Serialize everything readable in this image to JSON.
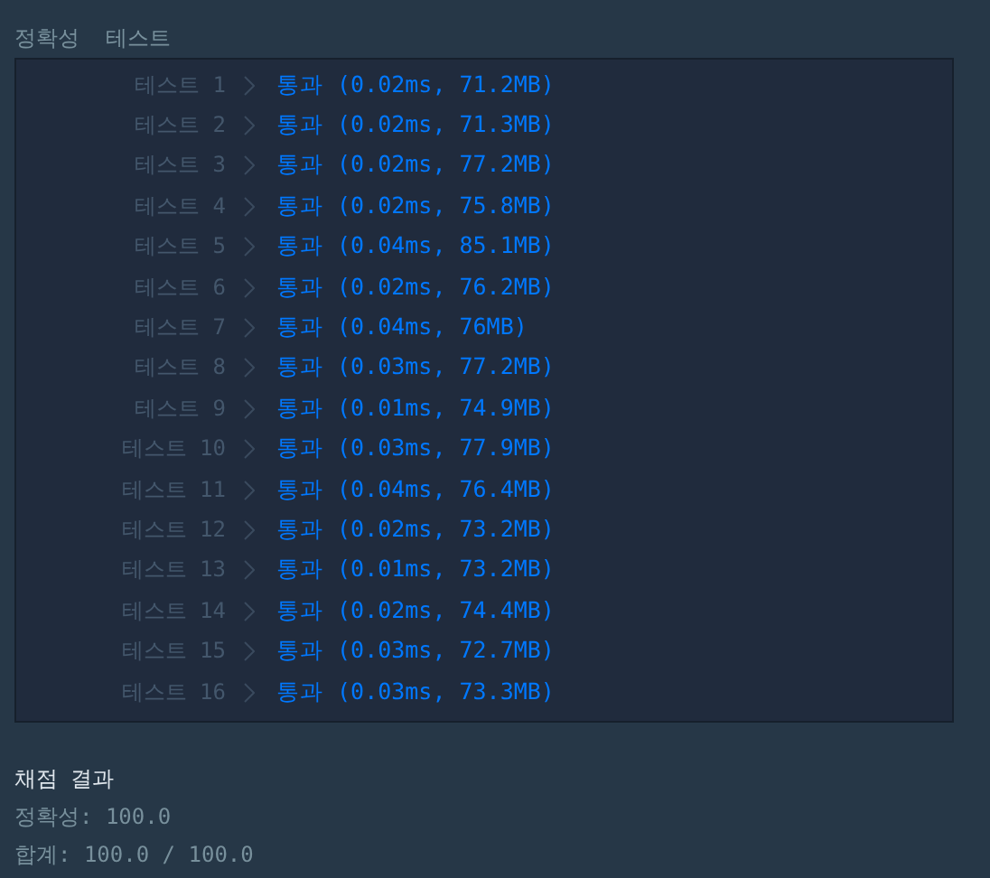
{
  "section_title": "정확성  테스트",
  "tests": [
    {
      "label": "테스트 1",
      "result": "통과 (0.02ms, 71.2MB)"
    },
    {
      "label": "테스트 2",
      "result": "통과 (0.02ms, 71.3MB)"
    },
    {
      "label": "테스트 3",
      "result": "통과 (0.02ms, 77.2MB)"
    },
    {
      "label": "테스트 4",
      "result": "통과 (0.02ms, 75.8MB)"
    },
    {
      "label": "테스트 5",
      "result": "통과 (0.04ms, 85.1MB)"
    },
    {
      "label": "테스트 6",
      "result": "통과 (0.02ms, 76.2MB)"
    },
    {
      "label": "테스트 7",
      "result": "통과 (0.04ms, 76MB)"
    },
    {
      "label": "테스트 8",
      "result": "통과 (0.03ms, 77.2MB)"
    },
    {
      "label": "테스트 9",
      "result": "통과 (0.01ms, 74.9MB)"
    },
    {
      "label": "테스트 10",
      "result": "통과 (0.03ms, 77.9MB)"
    },
    {
      "label": "테스트 11",
      "result": "통과 (0.04ms, 76.4MB)"
    },
    {
      "label": "테스트 12",
      "result": "통과 (0.02ms, 73.2MB)"
    },
    {
      "label": "테스트 13",
      "result": "통과 (0.01ms, 73.2MB)"
    },
    {
      "label": "테스트 14",
      "result": "통과 (0.02ms, 74.4MB)"
    },
    {
      "label": "테스트 15",
      "result": "통과 (0.03ms, 72.7MB)"
    },
    {
      "label": "테스트 16",
      "result": "통과 (0.03ms, 73.3MB)"
    }
  ],
  "summary": {
    "title": "채점 결과",
    "lines": [
      "정확성: 100.0",
      "합계: 100.0 / 100.0"
    ]
  }
}
